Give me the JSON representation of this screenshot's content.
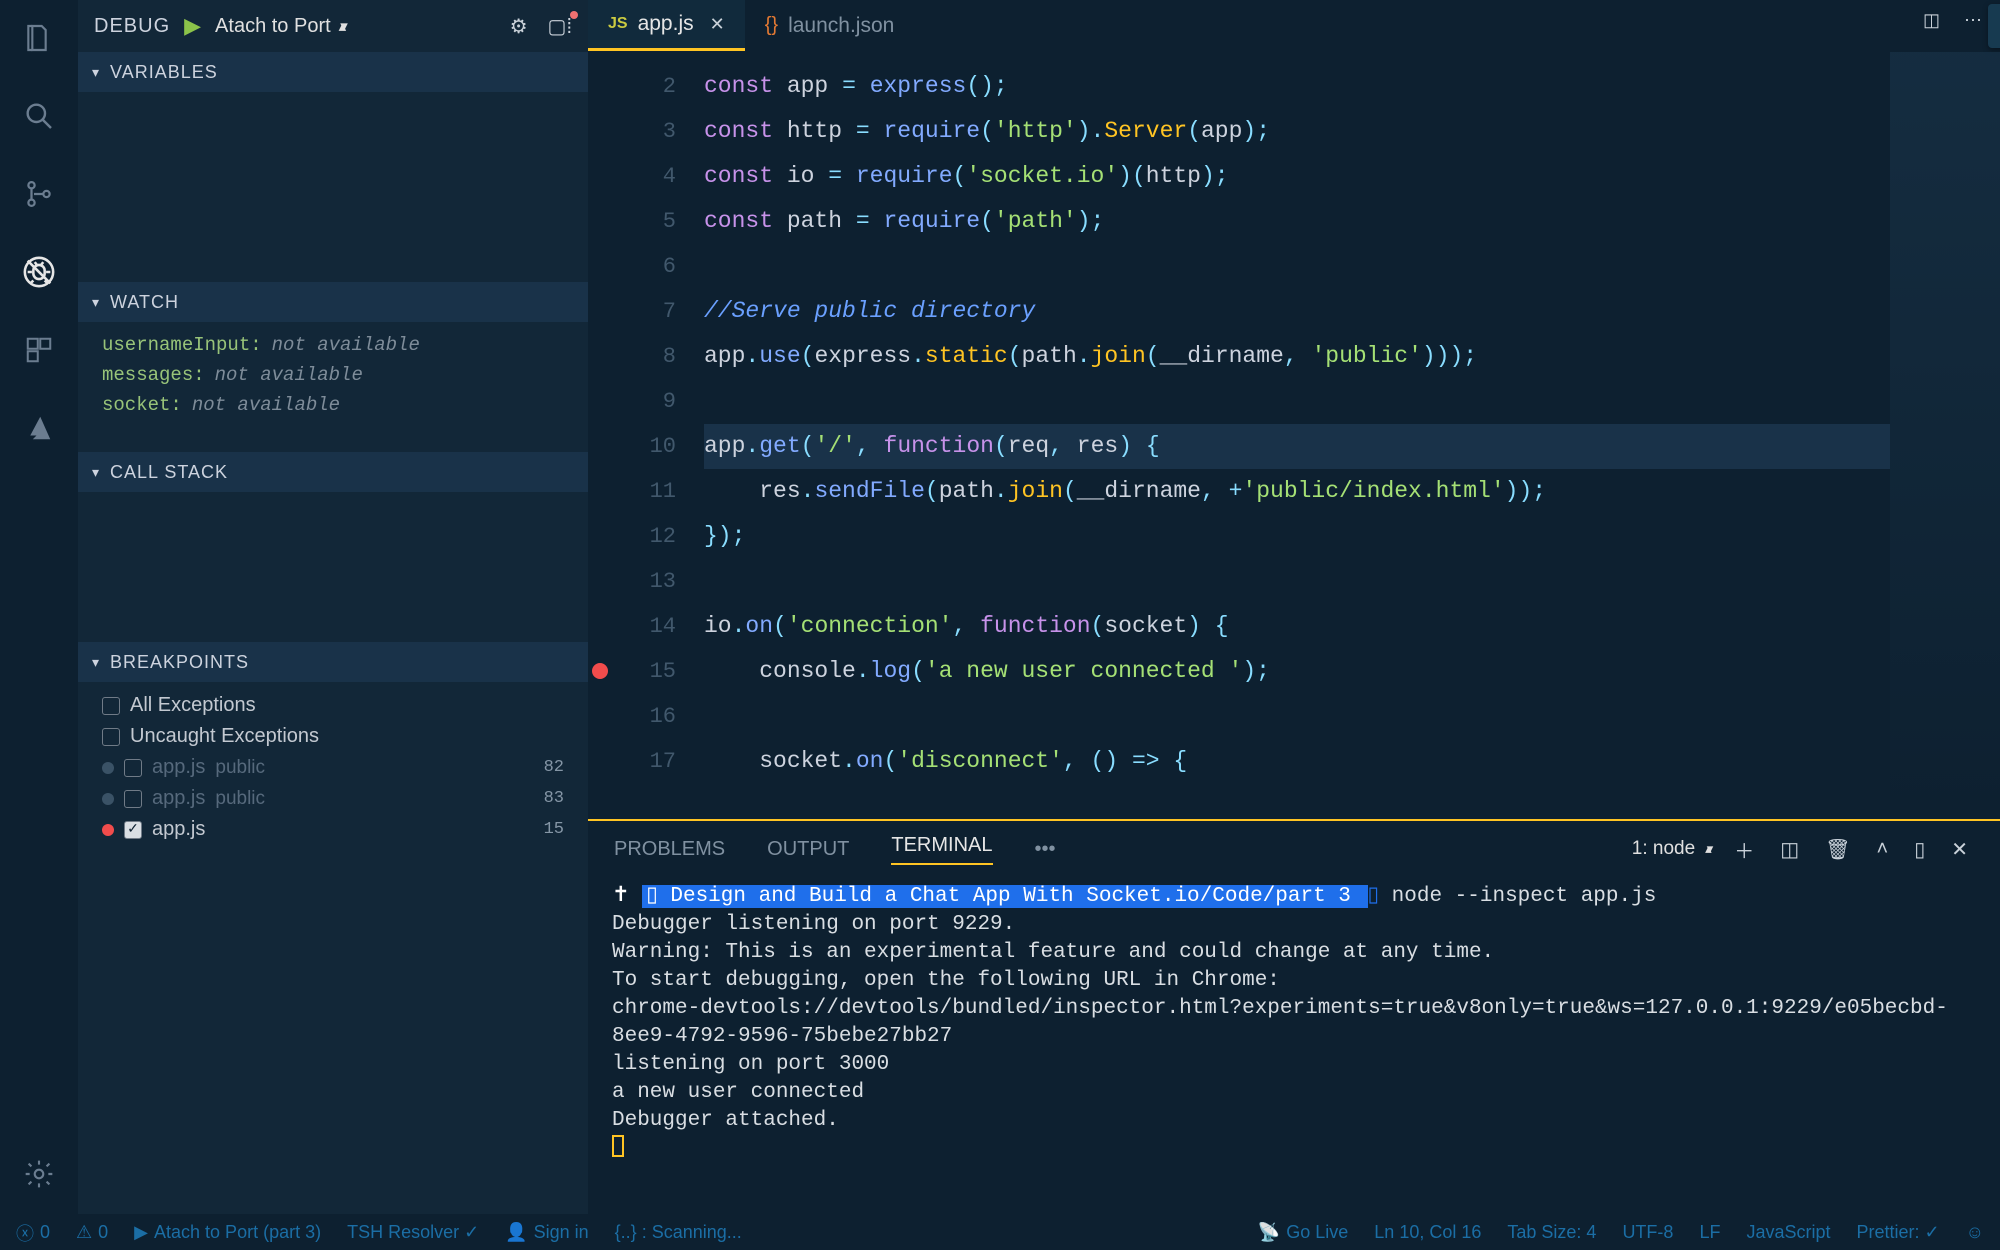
{
  "activity": {
    "active": "debug"
  },
  "debug_header": {
    "label": "DEBUG",
    "config": "Atach to Port"
  },
  "sections": {
    "variables": "VARIABLES",
    "watch": "WATCH",
    "callstack": "CALL STACK",
    "breakpoints": "BREAKPOINTS"
  },
  "watch": [
    {
      "name": "usernameInput:",
      "status": "not available"
    },
    {
      "name": "messages:",
      "status": "not available"
    },
    {
      "name": "socket:",
      "status": "not available"
    }
  ],
  "breakpoints": {
    "all_exceptions": "All Exceptions",
    "uncaught_exceptions": "Uncaught Exceptions",
    "items": [
      {
        "file": "app.js",
        "folder": "public",
        "line": "82",
        "dim": true,
        "checked": false
      },
      {
        "file": "app.js",
        "folder": "public",
        "line": "83",
        "dim": true,
        "checked": false
      },
      {
        "file": "app.js",
        "folder": "",
        "line": "15",
        "dim": false,
        "checked": true
      }
    ]
  },
  "tabs": [
    {
      "label": "app.js",
      "kind": "js",
      "active": true,
      "dirty": false
    },
    {
      "label": "launch.json",
      "kind": "json",
      "active": false,
      "dirty": false
    }
  ],
  "code_lines": [
    {
      "n": "2",
      "html": "<span class='kw'>const</span> <span class='id'>app</span> <span class='op'>=</span> <span class='fn'>express</span><span class='pn'>();</span>"
    },
    {
      "n": "3",
      "html": "<span class='kw'>const</span> <span class='id'>http</span> <span class='op'>=</span> <span class='fn'>require</span><span class='pn'>(</span><span class='str'>'http'</span><span class='pn'>).</span><span class='fnc'>Server</span><span class='pn'>(</span><span class='id'>app</span><span class='pn'>);</span>"
    },
    {
      "n": "4",
      "html": "<span class='kw'>const</span> <span class='id'>io</span> <span class='op'>=</span> <span class='fn'>require</span><span class='pn'>(</span><span class='str'>'socket.io'</span><span class='pn'>)(</span><span class='id'>http</span><span class='pn'>);</span>"
    },
    {
      "n": "5",
      "html": "<span class='kw'>const</span> <span class='id'>path</span> <span class='op'>=</span> <span class='fn'>require</span><span class='pn'>(</span><span class='str'>'path'</span><span class='pn'>);</span>"
    },
    {
      "n": "6",
      "html": ""
    },
    {
      "n": "7",
      "html": "<span class='cm'>//Serve public directory</span>"
    },
    {
      "n": "8",
      "html": "<span class='id'>app</span><span class='pn'>.</span><span class='fn'>use</span><span class='pn'>(</span><span class='id'>express</span><span class='pn'>.</span><span class='fnc'>static</span><span class='pn'>(</span><span class='id'>path</span><span class='pn'>.</span><span class='fnc'>join</span><span class='pn'>(</span><span class='id'>__dirname</span><span class='pn'>,</span> <span class='str'>'public'</span><span class='pn'>)));</span>"
    },
    {
      "n": "9",
      "html": ""
    },
    {
      "n": "10",
      "html": "<span class='id'>app</span><span class='pn'>.</span><span class='fn'>get</span><span class='pn'>(</span><span class='str'>'/'</span><span class='pn'>,</span> <span class='kw'>function</span><span class='pn'>(</span><span class='id'>req</span><span class='pn'>,</span> <span class='id'>res</span><span class='pn'>) {</span>",
      "hl": true
    },
    {
      "n": "11",
      "html": "    <span class='id'>res</span><span class='pn'>.</span><span class='fn'>sendFile</span><span class='pn'>(</span><span class='id'>path</span><span class='pn'>.</span><span class='fnc'>join</span><span class='pn'>(</span><span class='id'>__dirname</span><span class='pn'>,</span> <span class='op'>+</span><span class='str'>'public/index.html'</span><span class='pn'>));</span>"
    },
    {
      "n": "12",
      "html": "<span class='pn'>});</span>"
    },
    {
      "n": "13",
      "html": ""
    },
    {
      "n": "14",
      "html": "<span class='id'>io</span><span class='pn'>.</span><span class='fn'>on</span><span class='pn'>(</span><span class='str'>'connection'</span><span class='pn'>,</span> <span class='kw'>function</span><span class='pn'>(</span><span class='id'>socket</span><span class='pn'>) {</span>"
    },
    {
      "n": "15",
      "html": "    <span class='id'>console</span><span class='pn'>.</span><span class='fn'>log</span><span class='pn'>(</span><span class='str'>'a new user connected '</span><span class='pn'>);</span>",
      "bp": true
    },
    {
      "n": "16",
      "html": ""
    },
    {
      "n": "17",
      "html": "    <span class='id'>socket</span><span class='pn'>.</span><span class='fn'>on</span><span class='pn'>(</span><span class='str'>'disconnect'</span><span class='pn'>,</span> <span class='pn'>() =&gt; {</span>"
    }
  ],
  "panel": {
    "tabs": {
      "problems": "PROBLEMS",
      "output": "OUTPUT",
      "terminal": "TERMINAL"
    },
    "term_select": "1: node"
  },
  "terminal": {
    "prompt_path": " Design and Build a Chat App With Socket.io/Code/part 3 ",
    "cmd": " node --inspect app.js",
    "lines": [
      "Debugger listening on port 9229.",
      "Warning: This is an experimental feature and could change at any time.",
      "To start debugging, open the following URL in Chrome:",
      "    chrome-devtools://devtools/bundled/inspector.html?experiments=true&v8only=true&ws=127.0.0.1:9229/e05becbd-8ee9-4792-9596-75bebe27bb27",
      "listening on port 3000",
      "a new user connected",
      "Debugger attached."
    ]
  },
  "status": {
    "errors": "0",
    "warnings": "0",
    "launch": "Atach to Port (part 3)",
    "resolver": "TSH Resolver ✓",
    "signin": "Sign in",
    "scanning": "{..} : Scanning...",
    "golive": "Go Live",
    "pos": "Ln 10, Col 16",
    "tabsize": "Tab Size: 4",
    "eol": "LF",
    "enc": "UTF-8",
    "lang": "JavaScript",
    "prettier": "Prettier: ✓"
  }
}
